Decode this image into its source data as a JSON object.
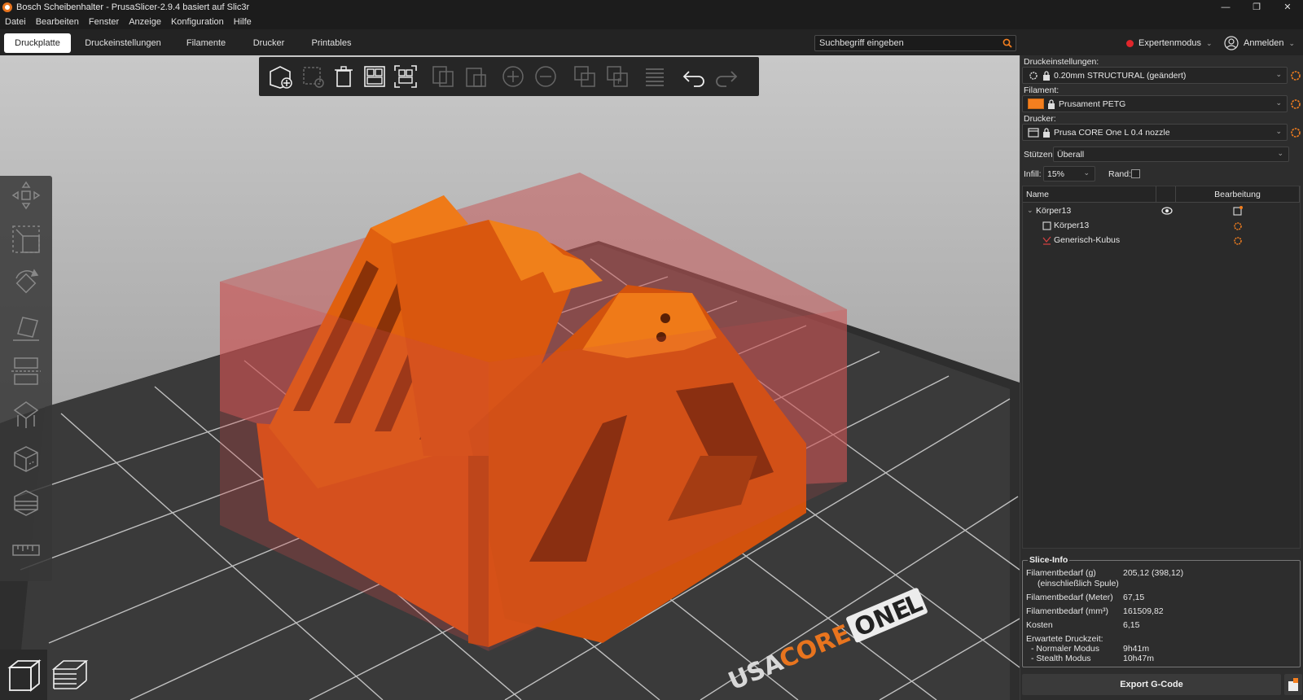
{
  "window": {
    "title": "Bosch Scheibenhalter - PrusaSlicer-2.9.4 basiert auf Slic3r",
    "controls": [
      "—",
      "❐",
      "✕"
    ]
  },
  "menu": [
    "Datei",
    "Bearbeiten",
    "Fenster",
    "Anzeige",
    "Konfiguration",
    "Hilfe"
  ],
  "tabs": [
    "Druckplatte",
    "Druckeinstellungen",
    "Filamente",
    "Drucker",
    "Printables"
  ],
  "active_tab": "Druckplatte",
  "search": {
    "placeholder": "Suchbegriff eingeben"
  },
  "mode": {
    "label": "Expertenmodus",
    "color": "#e0262b"
  },
  "login": {
    "label": "Anmelden"
  },
  "toolbar": {
    "icons": [
      "add-object-icon",
      "delete-icon",
      "delete-all-icon",
      "arrange-icon",
      "arrange-selection-icon",
      "copy-icon",
      "paste-icon",
      "add-instance-icon",
      "remove-instance-icon",
      "split-objects-icon",
      "split-parts-icon",
      "layers-editing-icon",
      "undo-icon",
      "redo-icon"
    ]
  },
  "left_gizmos": [
    "move-icon",
    "scale-icon",
    "rotate-icon",
    "place-on-face-icon",
    "cut-icon",
    "support-painting-icon",
    "seam-painting-icon",
    "mmu-painting-icon",
    "measure-icon"
  ],
  "view_switch": [
    "3d-view-icon",
    "preview-icon"
  ],
  "bed": {
    "label": "PRUSA CORE ONE L"
  },
  "sidebar": {
    "print_settings": {
      "label": "Druckeinstellungen:",
      "value": "0.20mm STRUCTURAL (geändert)"
    },
    "filament": {
      "label": "Filament:",
      "value": "Prusament PETG",
      "color": "#f47f1f"
    },
    "printer": {
      "label": "Drucker:",
      "value": "Prusa CORE One L 0.4 nozzle"
    },
    "supports": {
      "label": "Stützen:",
      "value": "Überall"
    },
    "infill": {
      "label": "Infill:",
      "value": "15%"
    },
    "brim": {
      "label": "Rand:",
      "checked": false
    },
    "object_list": {
      "columns": [
        "Name",
        "Bearbeitung"
      ],
      "rows": [
        {
          "name": "Körper13",
          "level": 0
        },
        {
          "name": "Körper13",
          "level": 1
        },
        {
          "name": "Generisch-Kubus",
          "level": 1
        }
      ]
    },
    "slice_info": {
      "title": "Slice-Info",
      "filament_g_label_1": "Filamentbedarf (g)",
      "filament_g_label_2": "(einschließlich Spule)",
      "filament_g_value": "205,12 (398,12)",
      "filament_m_label": "Filamentbedarf (Meter)",
      "filament_m_value": "67,15",
      "filament_mm3_label": "Filamentbedarf (mm³)",
      "filament_mm3_value": "161509,82",
      "cost_label": "Kosten",
      "cost_value": "6,15",
      "time_label": "Erwartete Druckzeit:",
      "normal_label": "- Normaler Modus",
      "normal_value": "9h41m",
      "stealth_label": "- Stealth Modus",
      "stealth_value": "10h47m"
    },
    "export_label": "Export G-Code"
  }
}
